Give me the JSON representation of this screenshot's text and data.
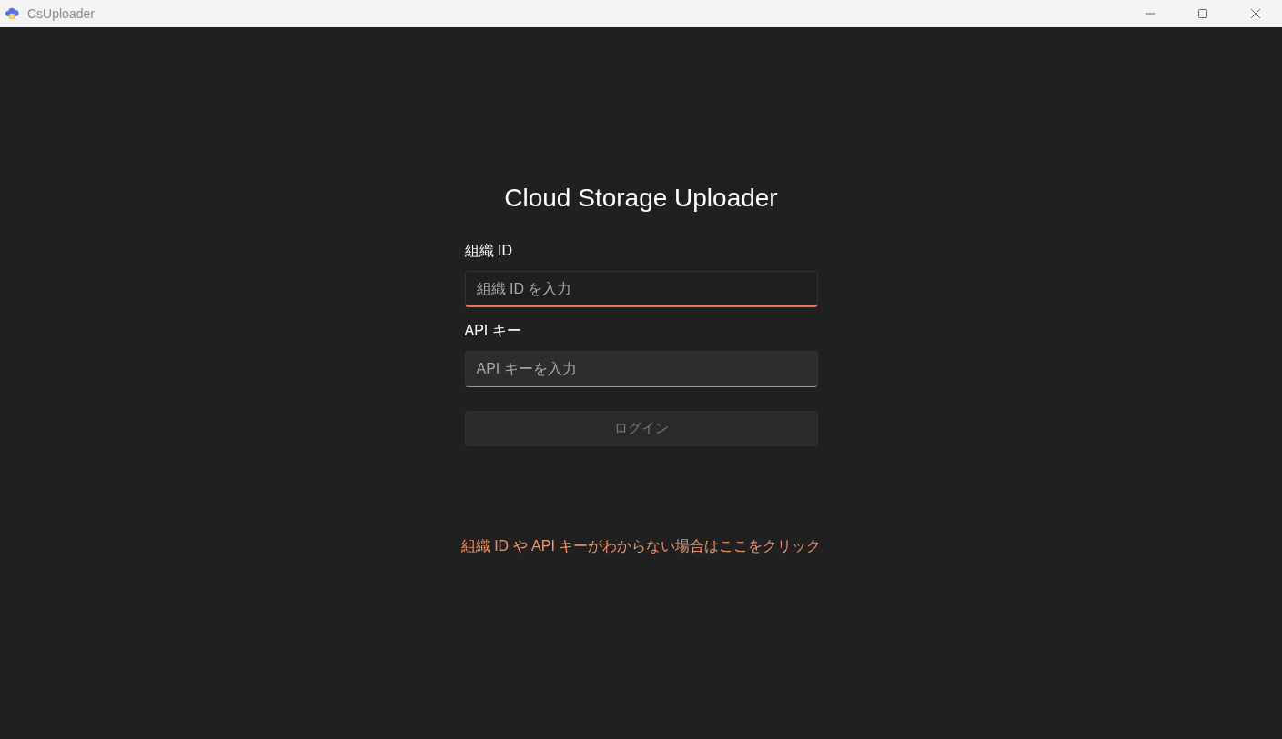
{
  "window": {
    "title": "CsUploader"
  },
  "heading": "Cloud Storage Uploader",
  "fields": [
    {
      "label": "組織 ID",
      "placeholder": "組織 ID を入力",
      "focused": true
    },
    {
      "label": "API キー",
      "placeholder": "API キーを入力",
      "focused": false
    }
  ],
  "login_button": {
    "label": "ログイン",
    "disabled": true
  },
  "help_link": "組織 ID や API キーがわからない場合はここをクリック"
}
